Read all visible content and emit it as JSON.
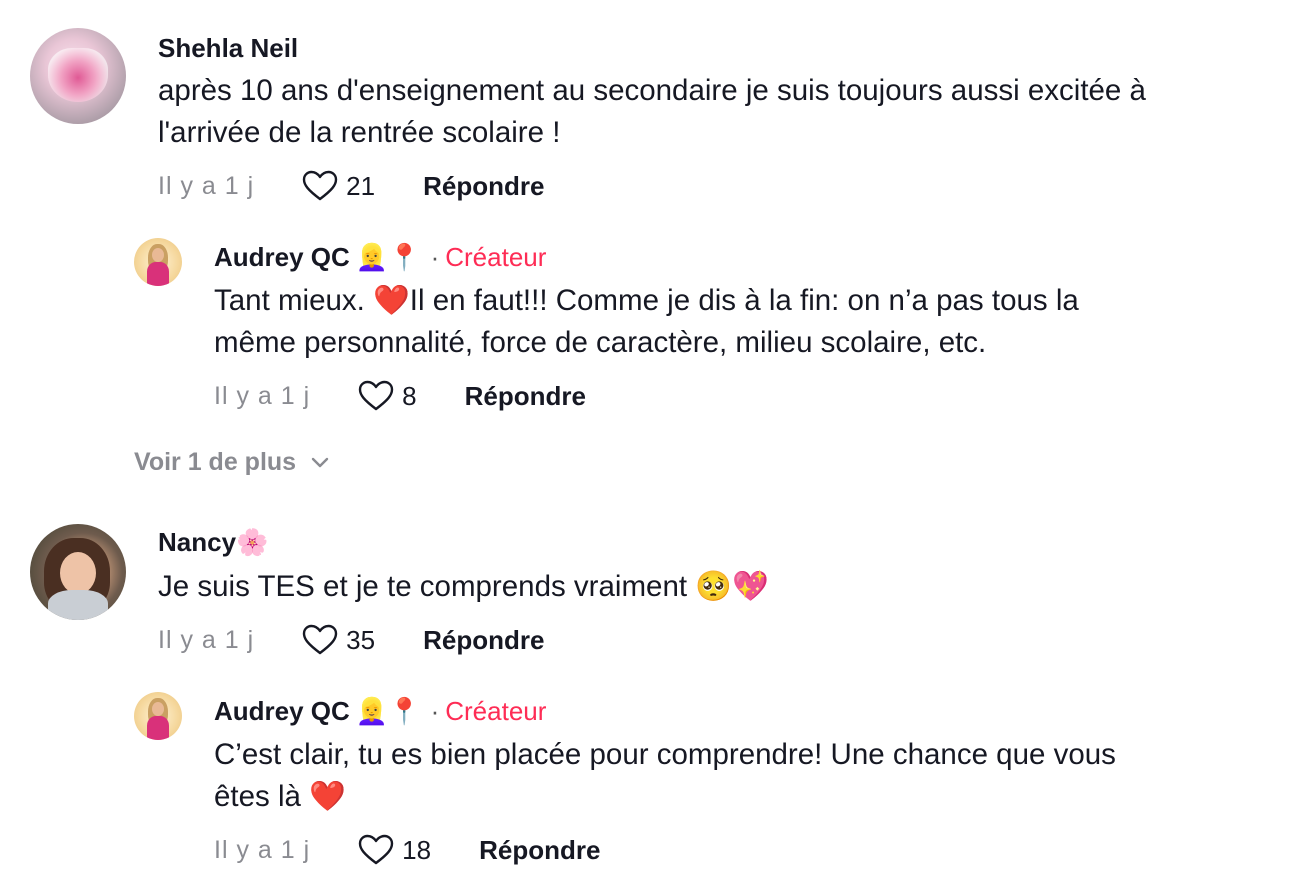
{
  "comments": [
    {
      "username": "Shehla Neil",
      "text_lines": [
        "après 10 ans d'enseignement au secondaire je suis toujours aussi excitée à",
        "l'arrivée de la rentrée scolaire !"
      ],
      "time": "Il y a 1 j",
      "likes": "21",
      "reply_label": "Répondre",
      "avatar_icon": "heart-glass-avatar"
    },
    {
      "username": "Audrey QC",
      "name_emojis": "👱‍♀️📍",
      "separator": "·",
      "badge": "Créateur",
      "text_lines": [
        "Tant mieux. ❤️Il en faut!!! Comme je dis à la fin: on n’a pas tous la",
        "même personnalité, force de caractère, milieu scolaire, etc."
      ],
      "time": "Il y a 1 j",
      "likes": "8",
      "reply_label": "Répondre"
    },
    {
      "username": "Nancy",
      "name_emojis": "🌸",
      "text_lines": [
        "Je suis TES et je te comprends vraiment 🥺💖"
      ],
      "time": "Il y a 1 j",
      "likes": "35",
      "reply_label": "Répondre"
    },
    {
      "username": "Audrey QC",
      "name_emojis": "👱‍♀️📍",
      "separator": "·",
      "badge": "Créateur",
      "text_lines": [
        "C’est clair, tu es bien placée pour comprendre! Une chance que vous",
        "êtes là ❤️"
      ],
      "time": "Il y a 1 j",
      "likes": "18",
      "reply_label": "Répondre"
    }
  ],
  "more_replies_label": "Voir 1 de plus",
  "colors": {
    "accent": "#fe2c55",
    "muted": "#8a8b91",
    "text": "#161823"
  }
}
